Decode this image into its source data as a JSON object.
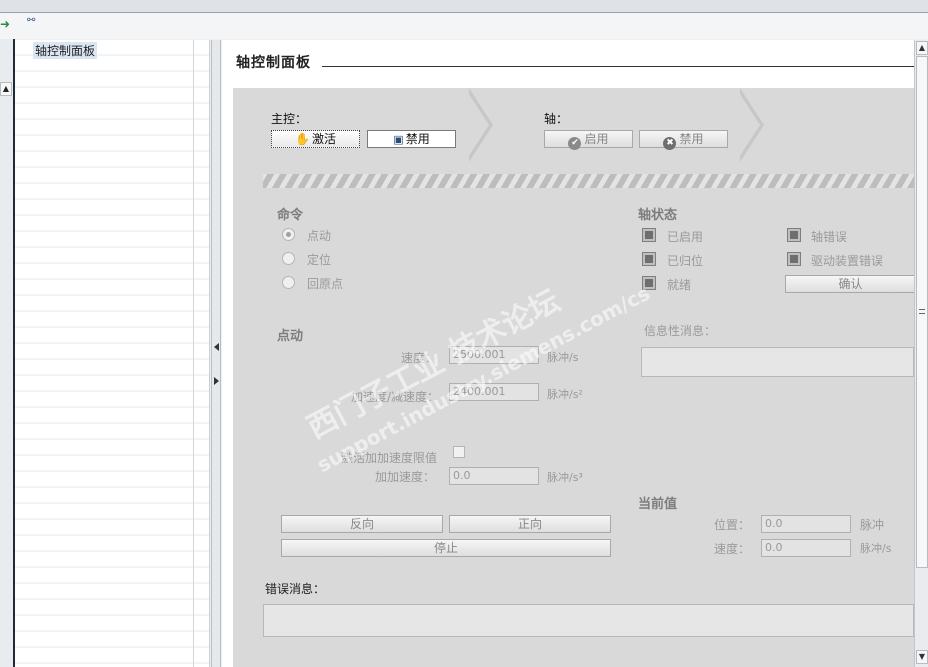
{
  "tree": {
    "item": "轴控制面板"
  },
  "title": "轴控制面板",
  "master": {
    "label": "主控：",
    "activate": "激活",
    "disable": "禁用"
  },
  "axis": {
    "label": "轴：",
    "enable": "启用",
    "disable": "禁用"
  },
  "command": {
    "header": "命令",
    "options": [
      "点动",
      "定位",
      "回原点"
    ]
  },
  "status": {
    "header": "轴状态",
    "enabled": "已启用",
    "homed": "已归位",
    "ready": "就绪",
    "error": "轴错误",
    "drive_error": "驱动装置错误",
    "confirm": "确认"
  },
  "jog": {
    "header": "点动",
    "speed_label": "速度：",
    "speed_value": "2500.001",
    "speed_unit": "脉冲/s",
    "accel_label": "加速度/减速度：",
    "accel_value": "2400.001",
    "accel_unit": "脉冲/s²",
    "jerk_enable_label": "激活加加速度限值",
    "jerk_label": "加加速度：",
    "jerk_value": "0.0",
    "jerk_unit": "脉冲/s³",
    "reverse": "反向",
    "forward": "正向",
    "stop": "停止"
  },
  "info": {
    "label": "信息性消息："
  },
  "current": {
    "header": "当前值",
    "position_label": "位置：",
    "position_value": "0.0",
    "position_unit": "脉冲",
    "speed_label": "速度：",
    "speed_value": "0.0",
    "speed_unit": "脉冲/s"
  },
  "error": {
    "label": "错误消息："
  },
  "watermark": {
    "line1": "西门子工业 技术论坛",
    "line2": "support.industry.siemens.com/cs"
  },
  "colors": {
    "panel": "#d9d9d9",
    "dim_text": "#9a9a9a"
  }
}
